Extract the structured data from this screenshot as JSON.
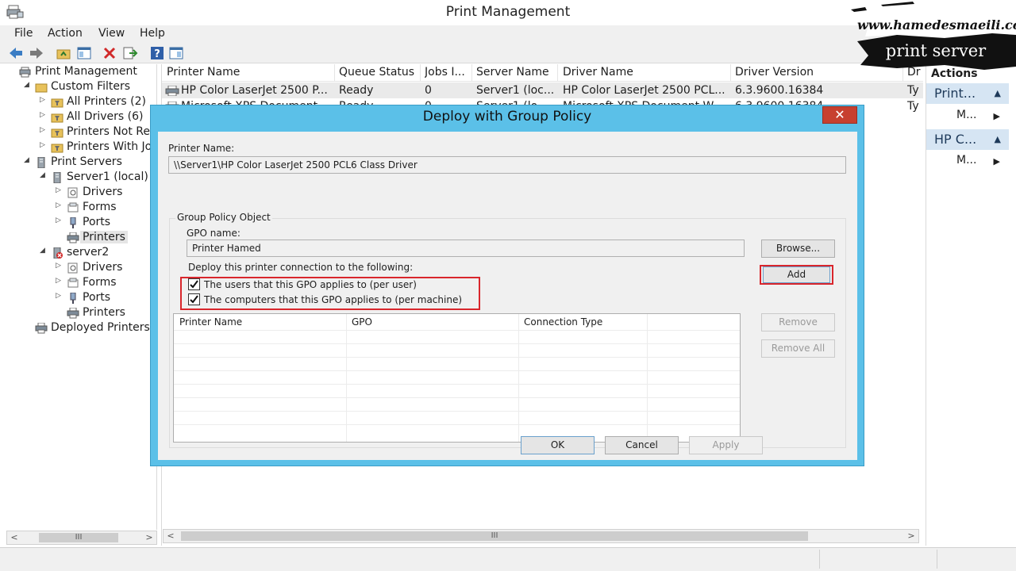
{
  "window": {
    "title": "Print Management"
  },
  "menu": [
    "File",
    "Action",
    "View",
    "Help"
  ],
  "watermark": {
    "url": "www.hamedesmaeili.com",
    "label": "print server"
  },
  "tree": [
    {
      "label": "Print Management",
      "icon": "print-management-icon",
      "expander": ""
    },
    {
      "label": "Custom Filters",
      "icon": "folder-icon",
      "expander": "◢"
    },
    {
      "label": "All Printers (2)",
      "icon": "filter-icon",
      "expander": "▷"
    },
    {
      "label": "All Drivers (6)",
      "icon": "filter-icon",
      "expander": "▷"
    },
    {
      "label": "Printers Not Rea",
      "icon": "filter-icon",
      "expander": "▷"
    },
    {
      "label": "Printers With Jol",
      "icon": "filter-icon",
      "expander": "▷"
    },
    {
      "label": "Print Servers",
      "icon": "server-icon",
      "expander": "◢"
    },
    {
      "label": "Server1 (local)",
      "icon": "server-icon",
      "expander": "◢"
    },
    {
      "label": "Drivers",
      "icon": "drivers-icon",
      "expander": "▷"
    },
    {
      "label": "Forms",
      "icon": "forms-icon",
      "expander": "▷"
    },
    {
      "label": "Ports",
      "icon": "ports-icon",
      "expander": "▷"
    },
    {
      "label": "Printers",
      "icon": "printer-icon",
      "expander": ""
    },
    {
      "label": "server2",
      "icon": "server-error-icon",
      "expander": "◢"
    },
    {
      "label": "Drivers",
      "icon": "drivers-icon",
      "expander": "▷"
    },
    {
      "label": "Forms",
      "icon": "forms-icon",
      "expander": "▷"
    },
    {
      "label": "Ports",
      "icon": "ports-icon",
      "expander": "▷"
    },
    {
      "label": "Printers",
      "icon": "printer-icon",
      "expander": ""
    },
    {
      "label": "Deployed Printers",
      "icon": "printer-icon",
      "expander": ""
    }
  ],
  "tree_scroll_thumb": "III",
  "list": {
    "columns": [
      "Printer Name",
      "Queue Status",
      "Jobs I...",
      "Server Name",
      "Driver Name",
      "Driver Version",
      "Dr"
    ],
    "rows": [
      [
        "HP Color LaserJet 2500 P...",
        "Ready",
        "0",
        "Server1 (loc...",
        "HP Color LaserJet 2500 PCL...",
        "6.3.9600.16384",
        "Ty"
      ],
      [
        "Microsoft XPS Document ...",
        "Ready",
        "0",
        "Server1 (lo...",
        "Microsoft XPS Document W...",
        "6.3.9600.16384",
        "Ty"
      ]
    ],
    "scroll_thumb": "III"
  },
  "actions": {
    "title": "Actions",
    "sections": [
      {
        "label": "Print...",
        "item": "M..."
      },
      {
        "label": "HP C...",
        "item": "M..."
      }
    ]
  },
  "dialog": {
    "title": "Deploy with Group Policy",
    "close": "✕",
    "printer_name_label": "Printer Name:",
    "printer_name_value": "\\\\Server1\\HP Color LaserJet 2500 PCL6 Class Driver",
    "group_title": "Group Policy Object",
    "gpo_name_label": "GPO name:",
    "gpo_name_value": "Printer Hamed",
    "browse": "Browse...",
    "deploy_label": "Deploy this printer connection to the following:",
    "check_user": {
      "label": "The users that this GPO applies to (per user)",
      "checked": true
    },
    "check_machine": {
      "label": "The computers that this GPO applies to (per machine)",
      "checked": true
    },
    "add": "Add",
    "remove": "Remove",
    "remove_all": "Remove All",
    "grid_columns": [
      "Printer Name",
      "GPO",
      "Connection Type"
    ],
    "ok": "OK",
    "cancel": "Cancel",
    "apply": "Apply"
  },
  "colors": {
    "dialog_frame": "#5bc0e8",
    "highlight": "#d9262c",
    "close_button": "#c7402f",
    "actions_section": "#d6e5f3"
  }
}
